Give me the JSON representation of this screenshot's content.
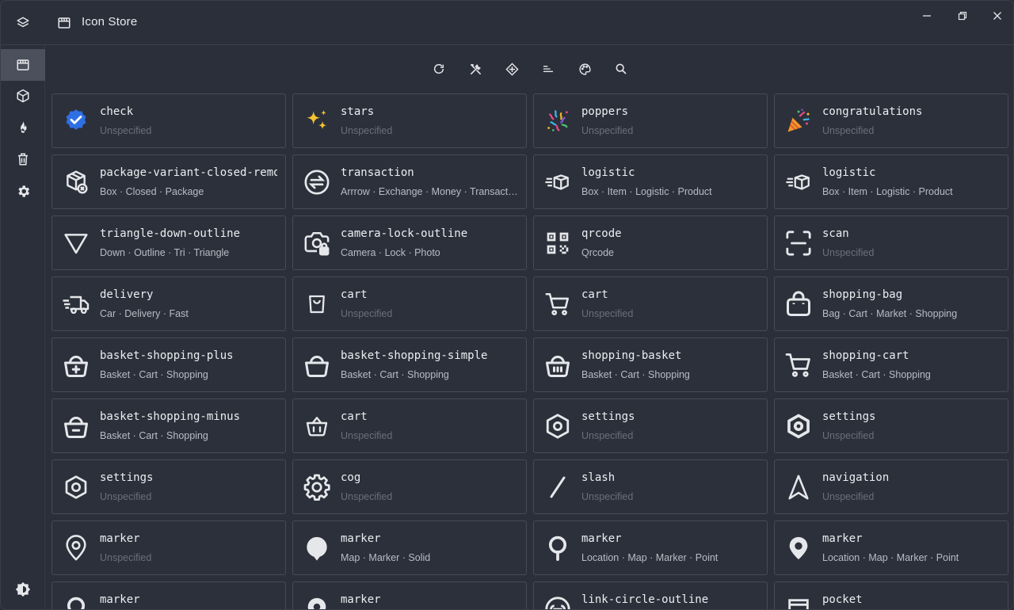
{
  "app": {
    "title": "Icon Store"
  },
  "window_controls": [
    "minimize",
    "restore",
    "close"
  ],
  "sidebar": {
    "items": [
      {
        "icon": "store-icon",
        "active": true
      },
      {
        "icon": "cube-icon",
        "active": false
      },
      {
        "icon": "fire-icon",
        "active": false
      },
      {
        "icon": "trash-icon",
        "active": false
      },
      {
        "icon": "gear-icon",
        "active": false
      }
    ]
  },
  "toolbar": [
    "refresh-icon",
    "tools-icon",
    "move-icon",
    "sort-icon",
    "palette-icon",
    "search-icon"
  ],
  "cards": [
    {
      "name": "check",
      "tags": "Unspecified"
    },
    {
      "name": "stars",
      "tags": "Unspecified"
    },
    {
      "name": "poppers",
      "tags": "Unspecified"
    },
    {
      "name": "congratulations",
      "tags": "Unspecified"
    },
    {
      "name": "package-variant-closed-remove",
      "tags": "Box · Closed · Package"
    },
    {
      "name": "transaction",
      "tags": "Arrrow · Exchange · Money · Transaction"
    },
    {
      "name": "logistic",
      "tags": "Box · Item · Logistic · Product"
    },
    {
      "name": "logistic",
      "tags": "Box · Item · Logistic · Product"
    },
    {
      "name": "triangle-down-outline",
      "tags": "Down · Outline · Tri · Triangle"
    },
    {
      "name": "camera-lock-outline",
      "tags": "Camera · Lock · Photo"
    },
    {
      "name": "qrcode",
      "tags": "Qrcode"
    },
    {
      "name": "scan",
      "tags": "Unspecified"
    },
    {
      "name": "delivery",
      "tags": "Car · Delivery · Fast"
    },
    {
      "name": "cart",
      "tags": "Unspecified"
    },
    {
      "name": "cart",
      "tags": "Unspecified"
    },
    {
      "name": "shopping-bag",
      "tags": "Bag · Cart · Market · Shopping"
    },
    {
      "name": "basket-shopping-plus",
      "tags": "Basket · Cart · Shopping"
    },
    {
      "name": "basket-shopping-simple",
      "tags": "Basket · Cart · Shopping"
    },
    {
      "name": "shopping-basket",
      "tags": "Basket · Cart · Shopping"
    },
    {
      "name": "shopping-cart",
      "tags": "Basket · Cart · Shopping"
    },
    {
      "name": "basket-shopping-minus",
      "tags": "Basket · Cart · Shopping"
    },
    {
      "name": "cart",
      "tags": "Unspecified"
    },
    {
      "name": "settings",
      "tags": "Unspecified"
    },
    {
      "name": "settings",
      "tags": "Unspecified"
    },
    {
      "name": "settings",
      "tags": "Unspecified"
    },
    {
      "name": "cog",
      "tags": "Unspecified"
    },
    {
      "name": "slash",
      "tags": "Unspecified"
    },
    {
      "name": "navigation",
      "tags": "Unspecified"
    },
    {
      "name": "marker",
      "tags": "Unspecified"
    },
    {
      "name": "marker",
      "tags": "Map · Marker · Solid"
    },
    {
      "name": "marker",
      "tags": "Location · Map · Marker · Point"
    },
    {
      "name": "marker",
      "tags": "Location · Map · Marker · Point"
    },
    {
      "name": "marker",
      "tags": ""
    },
    {
      "name": "marker",
      "tags": ""
    },
    {
      "name": "link-circle-outline",
      "tags": ""
    },
    {
      "name": "pocket",
      "tags": ""
    }
  ],
  "colors": {
    "background": "#2b2f3a",
    "card_border": "#474b57",
    "sidebar_active": "#4b505c",
    "check_badge": "#2f6fe4",
    "icon": "#e6e7ea",
    "muted_text": "#6b6f7a"
  }
}
